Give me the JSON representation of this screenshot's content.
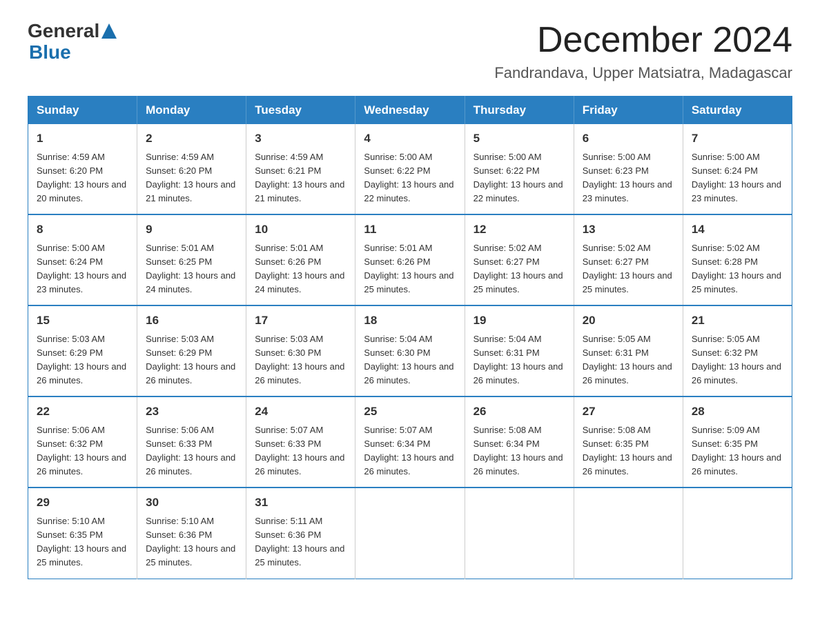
{
  "logo": {
    "general": "General",
    "blue": "Blue"
  },
  "title": "December 2024",
  "location": "Fandrandava, Upper Matsiatra, Madagascar",
  "days_of_week": [
    "Sunday",
    "Monday",
    "Tuesday",
    "Wednesday",
    "Thursday",
    "Friday",
    "Saturday"
  ],
  "weeks": [
    [
      {
        "day": "1",
        "sunrise": "Sunrise: 4:59 AM",
        "sunset": "Sunset: 6:20 PM",
        "daylight": "Daylight: 13 hours and 20 minutes."
      },
      {
        "day": "2",
        "sunrise": "Sunrise: 4:59 AM",
        "sunset": "Sunset: 6:20 PM",
        "daylight": "Daylight: 13 hours and 21 minutes."
      },
      {
        "day": "3",
        "sunrise": "Sunrise: 4:59 AM",
        "sunset": "Sunset: 6:21 PM",
        "daylight": "Daylight: 13 hours and 21 minutes."
      },
      {
        "day": "4",
        "sunrise": "Sunrise: 5:00 AM",
        "sunset": "Sunset: 6:22 PM",
        "daylight": "Daylight: 13 hours and 22 minutes."
      },
      {
        "day": "5",
        "sunrise": "Sunrise: 5:00 AM",
        "sunset": "Sunset: 6:22 PM",
        "daylight": "Daylight: 13 hours and 22 minutes."
      },
      {
        "day": "6",
        "sunrise": "Sunrise: 5:00 AM",
        "sunset": "Sunset: 6:23 PM",
        "daylight": "Daylight: 13 hours and 23 minutes."
      },
      {
        "day": "7",
        "sunrise": "Sunrise: 5:00 AM",
        "sunset": "Sunset: 6:24 PM",
        "daylight": "Daylight: 13 hours and 23 minutes."
      }
    ],
    [
      {
        "day": "8",
        "sunrise": "Sunrise: 5:00 AM",
        "sunset": "Sunset: 6:24 PM",
        "daylight": "Daylight: 13 hours and 23 minutes."
      },
      {
        "day": "9",
        "sunrise": "Sunrise: 5:01 AM",
        "sunset": "Sunset: 6:25 PM",
        "daylight": "Daylight: 13 hours and 24 minutes."
      },
      {
        "day": "10",
        "sunrise": "Sunrise: 5:01 AM",
        "sunset": "Sunset: 6:26 PM",
        "daylight": "Daylight: 13 hours and 24 minutes."
      },
      {
        "day": "11",
        "sunrise": "Sunrise: 5:01 AM",
        "sunset": "Sunset: 6:26 PM",
        "daylight": "Daylight: 13 hours and 25 minutes."
      },
      {
        "day": "12",
        "sunrise": "Sunrise: 5:02 AM",
        "sunset": "Sunset: 6:27 PM",
        "daylight": "Daylight: 13 hours and 25 minutes."
      },
      {
        "day": "13",
        "sunrise": "Sunrise: 5:02 AM",
        "sunset": "Sunset: 6:27 PM",
        "daylight": "Daylight: 13 hours and 25 minutes."
      },
      {
        "day": "14",
        "sunrise": "Sunrise: 5:02 AM",
        "sunset": "Sunset: 6:28 PM",
        "daylight": "Daylight: 13 hours and 25 minutes."
      }
    ],
    [
      {
        "day": "15",
        "sunrise": "Sunrise: 5:03 AM",
        "sunset": "Sunset: 6:29 PM",
        "daylight": "Daylight: 13 hours and 26 minutes."
      },
      {
        "day": "16",
        "sunrise": "Sunrise: 5:03 AM",
        "sunset": "Sunset: 6:29 PM",
        "daylight": "Daylight: 13 hours and 26 minutes."
      },
      {
        "day": "17",
        "sunrise": "Sunrise: 5:03 AM",
        "sunset": "Sunset: 6:30 PM",
        "daylight": "Daylight: 13 hours and 26 minutes."
      },
      {
        "day": "18",
        "sunrise": "Sunrise: 5:04 AM",
        "sunset": "Sunset: 6:30 PM",
        "daylight": "Daylight: 13 hours and 26 minutes."
      },
      {
        "day": "19",
        "sunrise": "Sunrise: 5:04 AM",
        "sunset": "Sunset: 6:31 PM",
        "daylight": "Daylight: 13 hours and 26 minutes."
      },
      {
        "day": "20",
        "sunrise": "Sunrise: 5:05 AM",
        "sunset": "Sunset: 6:31 PM",
        "daylight": "Daylight: 13 hours and 26 minutes."
      },
      {
        "day": "21",
        "sunrise": "Sunrise: 5:05 AM",
        "sunset": "Sunset: 6:32 PM",
        "daylight": "Daylight: 13 hours and 26 minutes."
      }
    ],
    [
      {
        "day": "22",
        "sunrise": "Sunrise: 5:06 AM",
        "sunset": "Sunset: 6:32 PM",
        "daylight": "Daylight: 13 hours and 26 minutes."
      },
      {
        "day": "23",
        "sunrise": "Sunrise: 5:06 AM",
        "sunset": "Sunset: 6:33 PM",
        "daylight": "Daylight: 13 hours and 26 minutes."
      },
      {
        "day": "24",
        "sunrise": "Sunrise: 5:07 AM",
        "sunset": "Sunset: 6:33 PM",
        "daylight": "Daylight: 13 hours and 26 minutes."
      },
      {
        "day": "25",
        "sunrise": "Sunrise: 5:07 AM",
        "sunset": "Sunset: 6:34 PM",
        "daylight": "Daylight: 13 hours and 26 minutes."
      },
      {
        "day": "26",
        "sunrise": "Sunrise: 5:08 AM",
        "sunset": "Sunset: 6:34 PM",
        "daylight": "Daylight: 13 hours and 26 minutes."
      },
      {
        "day": "27",
        "sunrise": "Sunrise: 5:08 AM",
        "sunset": "Sunset: 6:35 PM",
        "daylight": "Daylight: 13 hours and 26 minutes."
      },
      {
        "day": "28",
        "sunrise": "Sunrise: 5:09 AM",
        "sunset": "Sunset: 6:35 PM",
        "daylight": "Daylight: 13 hours and 26 minutes."
      }
    ],
    [
      {
        "day": "29",
        "sunrise": "Sunrise: 5:10 AM",
        "sunset": "Sunset: 6:35 PM",
        "daylight": "Daylight: 13 hours and 25 minutes."
      },
      {
        "day": "30",
        "sunrise": "Sunrise: 5:10 AM",
        "sunset": "Sunset: 6:36 PM",
        "daylight": "Daylight: 13 hours and 25 minutes."
      },
      {
        "day": "31",
        "sunrise": "Sunrise: 5:11 AM",
        "sunset": "Sunset: 6:36 PM",
        "daylight": "Daylight: 13 hours and 25 minutes."
      },
      null,
      null,
      null,
      null
    ]
  ]
}
